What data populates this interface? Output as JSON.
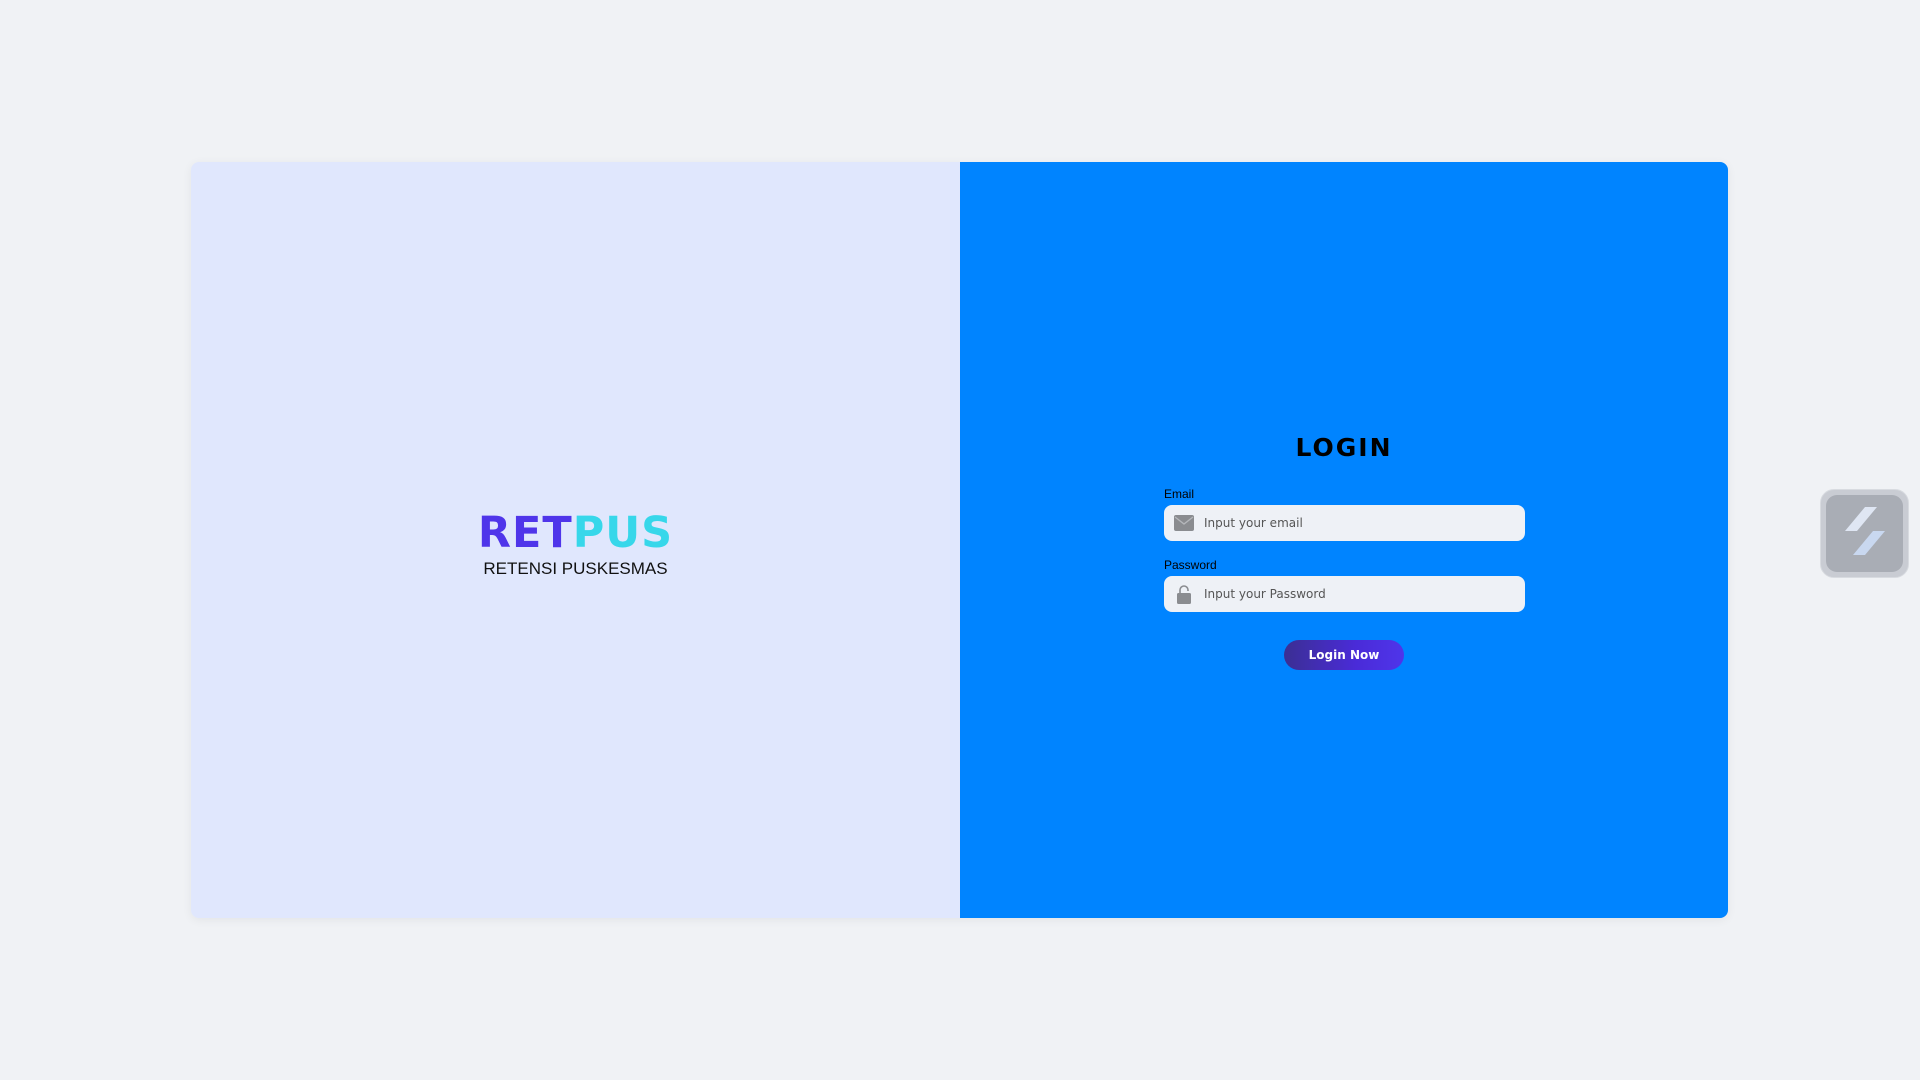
{
  "brand": {
    "logo_part1": "RET",
    "logo_part2": "PUS",
    "subtitle": "RETENSI PUSKESMAS",
    "colors": {
      "part1": "#4f35ea",
      "part2": "#37d7ea"
    }
  },
  "login": {
    "title": "LOGIN",
    "email": {
      "label": "Email",
      "placeholder": "Input your email",
      "value": "",
      "icon": "envelope-icon"
    },
    "password": {
      "label": "Password",
      "placeholder": "Input your Password",
      "value": "",
      "icon": "lock-icon"
    },
    "submit_label": "Login Now"
  },
  "widget": {
    "icon": "slash-stripes-icon"
  },
  "colors": {
    "page_bg": "#f0f2f5",
    "left_panel": "#e0e7fd",
    "right_panel": "#0084ff",
    "button": "#4f35ea"
  }
}
